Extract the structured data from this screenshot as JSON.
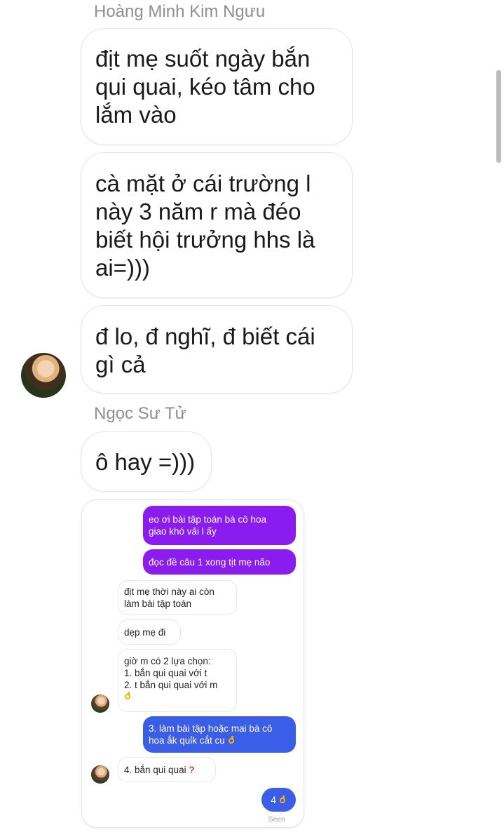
{
  "chat": {
    "group1_sender": "Hoàng Minh Kim Ngưu",
    "group1_messages": [
      "địt mẹ suốt ngày bắn\nqui quai, kéo tâm cho\nlắm vào",
      "cà mặt ở cái trường l\nnày 3 năm r mà đéo\nbiết hội trưởng hhs là\nai=)))",
      "đ lo, đ nghĩ, đ biết cái\ngì cả"
    ],
    "group2_sender": "Ngọc Sư Tử",
    "group2_messages": [
      "ô hay =)))"
    ]
  },
  "screenshot": {
    "messages": [
      {
        "dir": "out",
        "color": "#8a1cf0",
        "text": "eo ơi bài tập toán bà cô hoa\ngiao khó vãi l ấy"
      },
      {
        "dir": "out",
        "color": "#8a1cf0",
        "text": "đọc đề câu 1 xong tịt mẹ não"
      },
      {
        "dir": "in",
        "text": "địt mẹ thời này ai còn\nlàm bài tập toán"
      },
      {
        "dir": "in",
        "text": "dẹp mẹ đi"
      },
      {
        "dir": "in",
        "text": "giờ m có 2 lựa chọn:\n1. bắn qui quai với t\n2. t bắn qui quai với m"
      },
      {
        "dir": "out",
        "color": "#3b5ee8",
        "text": "3. làm bài tập hoặc mai bà cô\nhoa ắk quỉk cắt cu"
      },
      {
        "dir": "in",
        "text": "4. bắn qui quai"
      },
      {
        "dir": "out",
        "color": "#3b5ee8",
        "text": "4"
      }
    ],
    "seen_label": "Seen"
  },
  "icons": [
    "avatar",
    "ok-hand-icon",
    "question-mark-icon"
  ]
}
